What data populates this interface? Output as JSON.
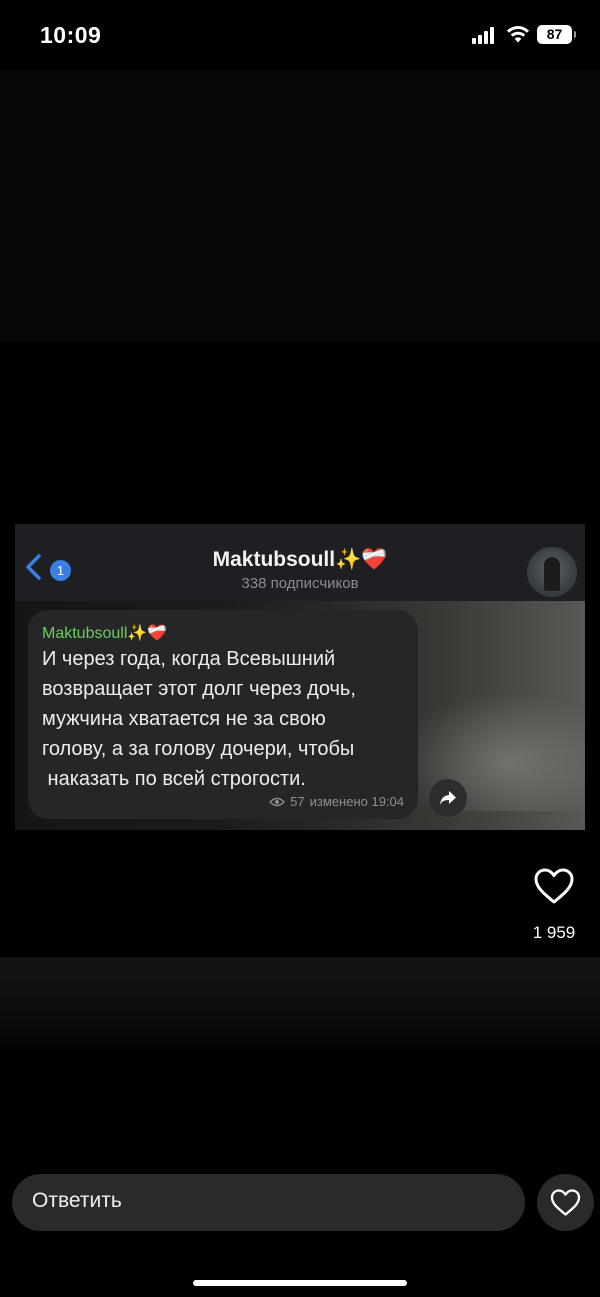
{
  "status_bar": {
    "time": "10:09",
    "battery": "87"
  },
  "story": {
    "channel_header": {
      "back_badge_count": "1",
      "title": "Maktubsoull✨❤️‍🩹",
      "subtitle": "338 подписчиков"
    },
    "message": {
      "sender": "Maktubsoull✨❤️‍🩹",
      "lines": [
        "И через года, когда Всевышний",
        "возвращает этот долг через дочь,",
        "мужчина хватается не за свою",
        "голову, а за голову дочери, чтобы",
        " наказать по всей строгости."
      ],
      "views": "57",
      "edited_time": "изменено 19:04"
    }
  },
  "actions": {
    "like_count": "1 959"
  },
  "reply": {
    "placeholder": "Ответить"
  },
  "colors": {
    "background": "#000000",
    "sender_green": "#6ecc5a",
    "badge_blue": "#3a7ee6",
    "bubble": "#252627",
    "reply_field": "#2a2a2c"
  },
  "icons": {
    "signal": "cellular-signal-icon",
    "wifi": "wifi-icon",
    "battery": "battery-icon",
    "back": "chevron-left-icon",
    "eye": "eye-icon",
    "forward": "forward-arrow-icon",
    "like": "heart-outline-icon"
  }
}
